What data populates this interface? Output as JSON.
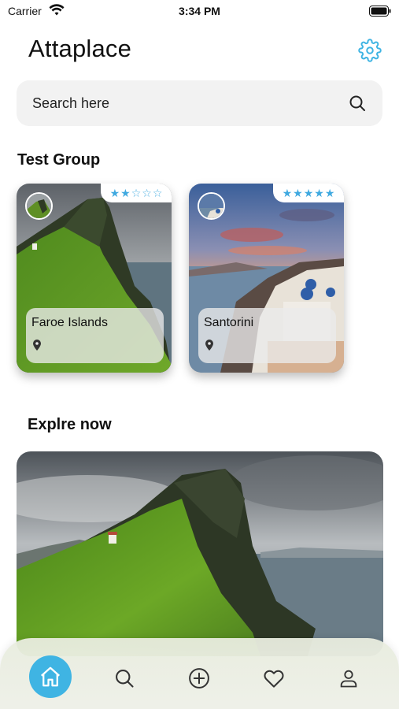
{
  "status_bar": {
    "carrier": "Carrier",
    "time": "3:34 PM"
  },
  "header": {
    "title": "Attaplace"
  },
  "search": {
    "placeholder": "Search here"
  },
  "group": {
    "title": "Test Group",
    "cards": [
      {
        "name": "Faroe Islands",
        "rating": 2,
        "max_rating": 5
      },
      {
        "name": "Santorini",
        "rating": 5,
        "max_rating": 5
      }
    ]
  },
  "explore": {
    "title": "Explre now"
  },
  "nav": {
    "items": [
      "home-icon",
      "search-icon",
      "add-icon",
      "heart-icon",
      "profile-icon"
    ]
  },
  "colors": {
    "accent": "#3fb4e3",
    "star": "#3fa9e0",
    "search_bg": "#f2f2f2"
  }
}
